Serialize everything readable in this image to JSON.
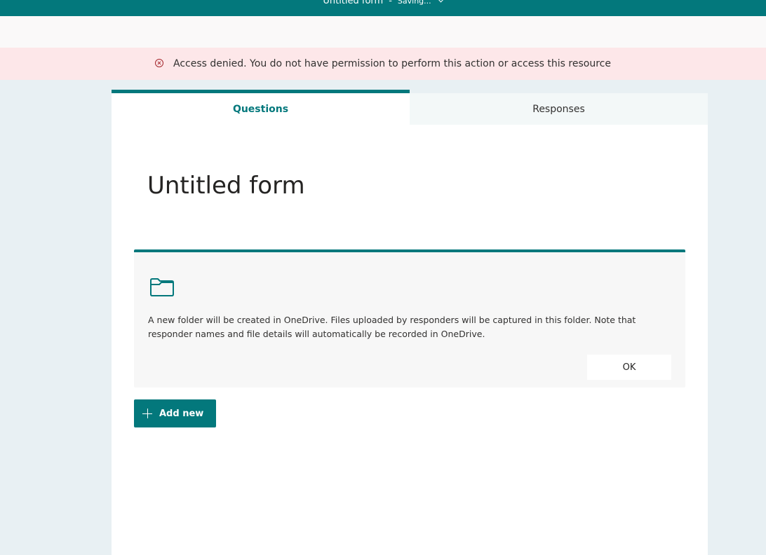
{
  "header": {
    "title": "Untitled form",
    "separator": "-",
    "status": "Saving..."
  },
  "error_banner": {
    "message": "Access denied. You do not have permission to perform this action or access this resource"
  },
  "tabs": [
    {
      "label": "Questions",
      "active": true
    },
    {
      "label": "Responses",
      "active": false
    }
  ],
  "form": {
    "title": "Untitled form"
  },
  "upload_notice": {
    "icon": "folder-icon",
    "text": "A new folder will be created in OneDrive. Files uploaded by responders will be captured in this folder. Note that responder names and file details will automatically be recorded in OneDrive.",
    "ok_label": "OK"
  },
  "actions": {
    "add_new_label": "Add new"
  },
  "colors": {
    "accent": "#03787c",
    "error_bg": "#fde7e9",
    "error_icon": "#a4262c"
  }
}
